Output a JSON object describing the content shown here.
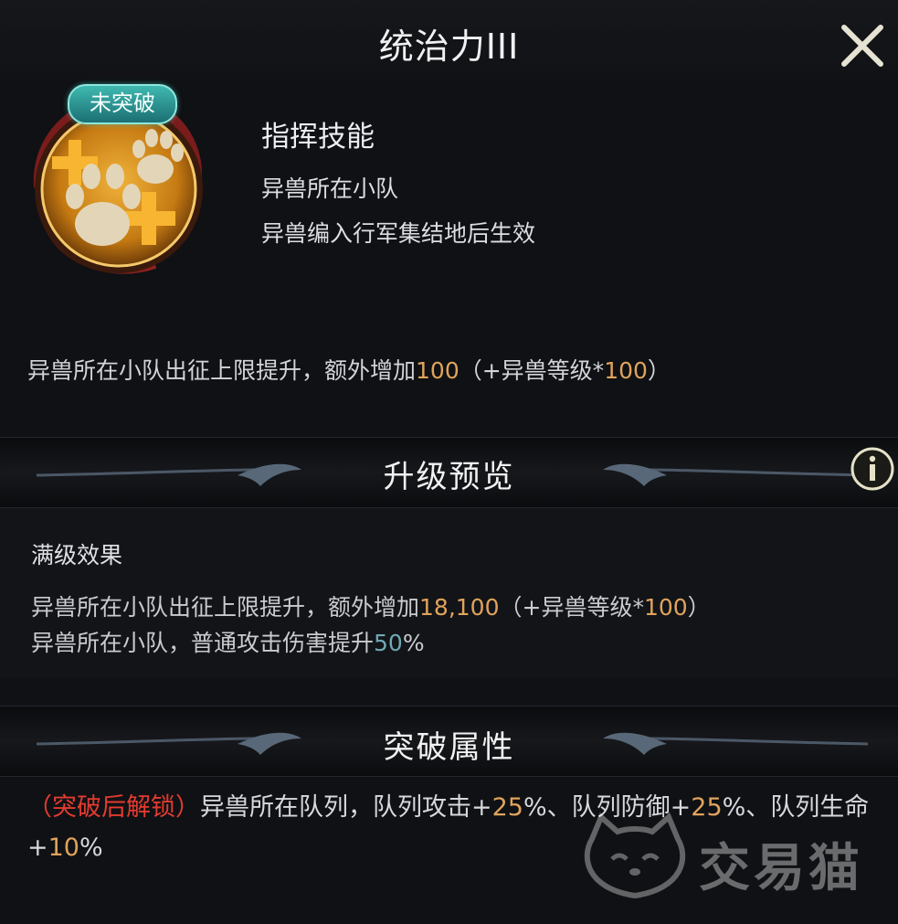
{
  "dialog": {
    "title": "统治力III"
  },
  "skill": {
    "badge": "未突破",
    "type": "指挥技能",
    "scope": "异兽所在小队",
    "condition": "异兽编入行军集结地后生效",
    "effect": {
      "prefix": "异兽所在小队出征上限提升，额外增加",
      "value": "100",
      "suffix_open": "（+异兽等级*",
      "suffix_value": "100",
      "suffix_close": "）"
    }
  },
  "upgrade_preview": {
    "title": "升级预览",
    "max_label": "满级效果",
    "line1": {
      "prefix": "异兽所在小队出征上限提升，额外增加",
      "value": "18,100",
      "suffix_open": "（+异兽等级*",
      "suffix_value": "100",
      "suffix_close": "）"
    },
    "line2": {
      "prefix": "异兽所在小队，普通攻击伤害提升",
      "value": "50",
      "suffix": "%"
    }
  },
  "breakthrough": {
    "title": "突破属性",
    "lock_label": "（突破后解锁）",
    "text1": "异兽所在队列，队列攻击+",
    "v1": "25",
    "text2": "%、队列防御+",
    "v2": "25",
    "text3": "%、队列生命+",
    "v3": "10",
    "text4": "%"
  },
  "watermark": {
    "text": "交易猫"
  },
  "icons": {
    "close": "close-icon",
    "info": "info-icon",
    "skill": "paw-plus-icon"
  },
  "colors": {
    "gold": "#e0a35c",
    "blue": "#6fa9b5",
    "red": "#e23b30",
    "badge": "#3fb9b0"
  }
}
